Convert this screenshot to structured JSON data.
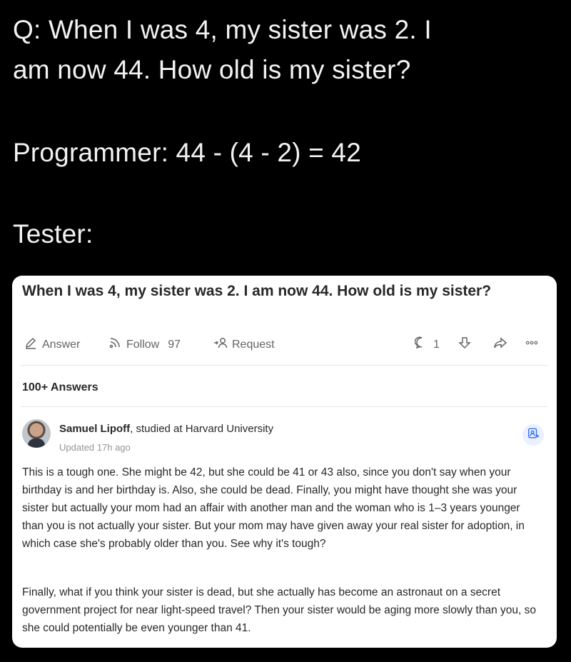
{
  "meme": {
    "line1": "Q: When I was 4, my sister was 2. I",
    "line2": "am now 44. How old is my sister?",
    "line3": "Programmer: 44 - (4 - 2) = 42",
    "line4": "Tester:"
  },
  "card": {
    "question_title": "When I was 4, my sister was 2. I am now 44. How old is my sister?",
    "actions": {
      "answer_label": "Answer",
      "follow_label": "Follow",
      "follow_count": "97",
      "request_label": "Request",
      "comment_count": "1"
    },
    "answers_count": "100+ Answers",
    "answer": {
      "author_name": "Samuel Lipoff",
      "credential": ", studied at Harvard University",
      "updated": "Updated 17h ago",
      "paragraph1": "This is a tough one. She might be 42, but she could be 41 or 43 also, since you don't say when your birthday is and her birthday is. Also, she could be dead. Finally, you might have thought she was your sister but actually your mom had an affair with another man and the woman who is 1–3 years younger than you is not actually your sister. But your mom may have given away your real sister for adoption, in which case she's probably older than you. See why it's tough?",
      "paragraph2": "Finally, what if you think your sister is dead, but she actually has become an astronaut on a secret government project for near light-speed travel? Then your sister would be aging more slowly than you, so she could potentially be even younger than 41."
    }
  },
  "icons": [
    "pencil-icon",
    "follow-feed-icon",
    "person-add-icon",
    "comment-icon",
    "downvote-icon",
    "share-icon",
    "more-icon",
    "id-badge-icon"
  ],
  "colors": {
    "background": "#000000",
    "card": "#ffffff",
    "text": "#282829",
    "muted": "#636466",
    "badge_bg": "#ebf0ff"
  }
}
